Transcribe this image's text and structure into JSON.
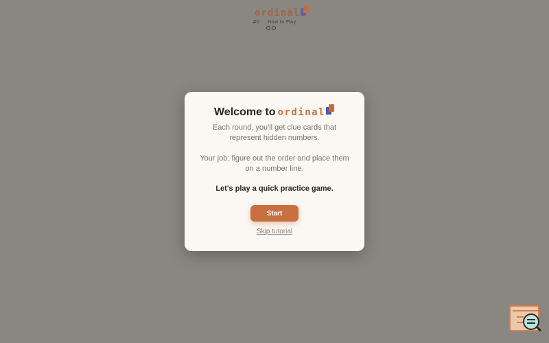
{
  "header": {
    "logo_text": "ordinal",
    "game_number": "#0",
    "how_to_play": "How to Play",
    "progress_dots": 2
  },
  "dialog": {
    "title_prefix": "Welcome to",
    "title_logo": "ordinal",
    "paragraph_1": "Each round, you'll get clue cards that represent hidden numbers.",
    "paragraph_2": "Your job: figure out the order and place them on a number line.",
    "paragraph_3": "Let's play a quick practice game.",
    "start_label": "Start",
    "skip_label": "Skip tutorial"
  },
  "colors": {
    "accent": "#c8703f",
    "logo_blue": "#4a5ba8",
    "backdrop": "#8a8681",
    "dialog_bg": "#fbf7f2"
  },
  "icons": {
    "logo_mark": "stacked-cards-icon",
    "corner_widget": "search-console-icon"
  }
}
